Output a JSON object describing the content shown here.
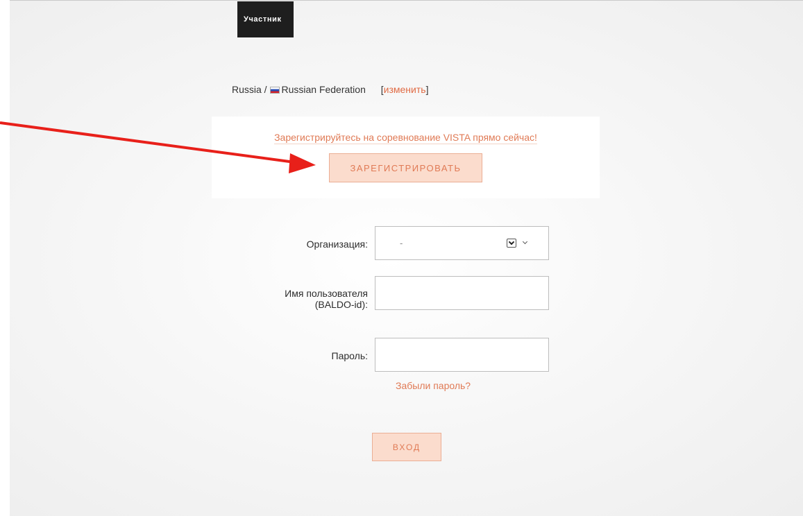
{
  "header": {
    "tab_label": "Участник"
  },
  "location": {
    "region": "Russia",
    "separator": " / ",
    "country": "Russian Federation",
    "change_link": "изменить",
    "bracket_open": "[",
    "bracket_close": "]"
  },
  "promo": {
    "text": "Зарегистрируйтесь на соревнование VISTA прямо сейчас!",
    "register_button": "Зарегистрировать"
  },
  "form": {
    "organization_label": "Организация:",
    "organization_value": "-",
    "username_label_line1": "Имя пользователя",
    "username_label_line2": "(BALDO-id):",
    "username_value": "",
    "password_label": "Пароль:",
    "password_value": "",
    "forgot_link": "Забыли пароль?",
    "login_button": "Вход"
  },
  "colors": {
    "accent": "#e07a55",
    "button_bg": "#fbdccd",
    "annotation_arrow": "#e8201a"
  }
}
